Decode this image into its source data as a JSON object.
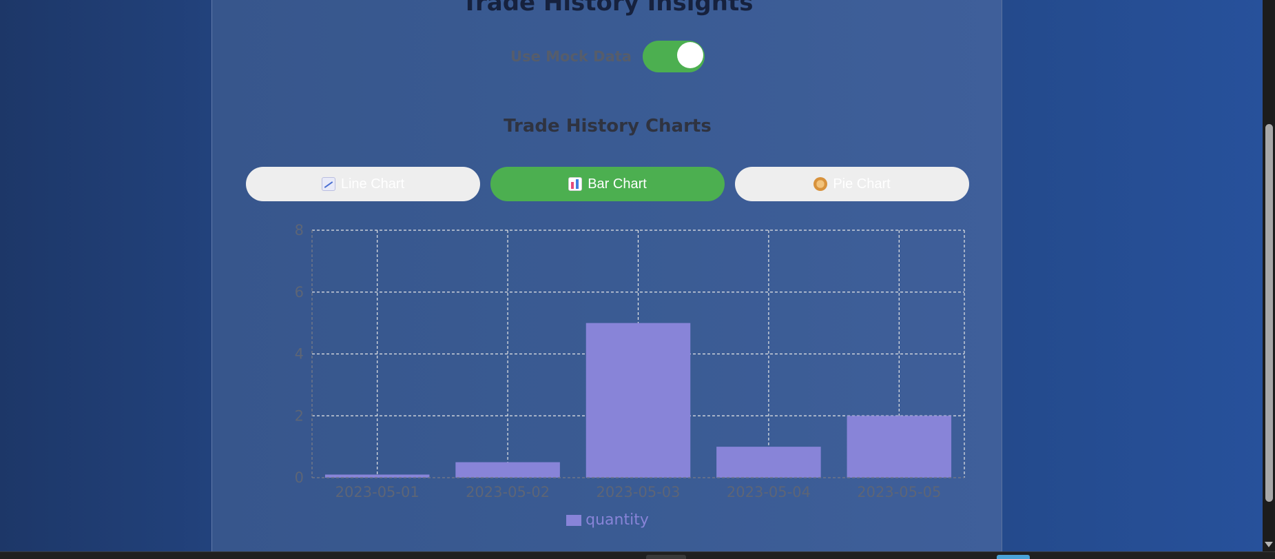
{
  "page": {
    "title": "Trade History Insights",
    "toggle_label": "Use Mock Data",
    "toggle_on": true,
    "section_title": "Trade History Charts"
  },
  "tabs": [
    {
      "label": "Line Chart",
      "icon": "line-chart-icon",
      "active": false
    },
    {
      "label": "Bar Chart",
      "icon": "bar-chart-icon",
      "active": true
    },
    {
      "label": "Pie Chart",
      "icon": "pie-chart-icon",
      "active": false
    }
  ],
  "colors": {
    "accent": "#4caf50",
    "bar": "#8884d8",
    "tab_inactive": "#eeeeee"
  },
  "chart_data": {
    "type": "bar",
    "categories": [
      "2023-05-01",
      "2023-05-02",
      "2023-05-03",
      "2023-05-04",
      "2023-05-05"
    ],
    "series": [
      {
        "name": "quantity",
        "values": [
          0.1,
          0.5,
          5,
          1,
          2
        ]
      }
    ],
    "ylim": [
      0,
      8
    ],
    "yticks": [
      "0",
      "2",
      "4",
      "6",
      "8"
    ],
    "grid": true,
    "legend": "bottom"
  }
}
